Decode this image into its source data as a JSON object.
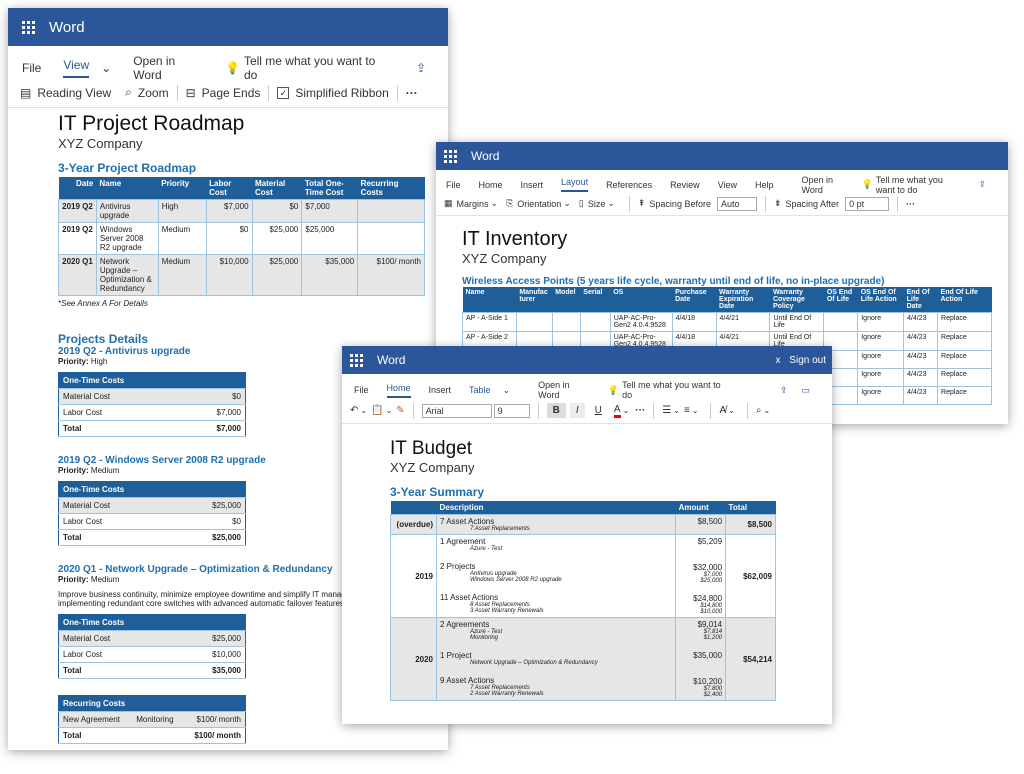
{
  "win1": {
    "app": "Word",
    "menu": [
      "File",
      "View",
      "Open in Word",
      "Tell me what you want to do"
    ],
    "toolbar": {
      "reading": "Reading View",
      "zoom": "Zoom",
      "page_ends": "Page Ends",
      "simplified": "Simplified Ribbon",
      "more": "···"
    },
    "doc": {
      "title": "IT Project Roadmap",
      "company": "XYZ Company",
      "section": "3-Year Project Roadmap",
      "headers": [
        "Date",
        "Name",
        "Priority",
        "Labor Cost",
        "Material Cost",
        "Total One-Time Cost",
        "Recurring Costs"
      ],
      "rows": [
        [
          "2019 Q2",
          "Antivirus upgrade",
          "High",
          "$7,000",
          "$0",
          "$7,000",
          ""
        ],
        [
          "2019 Q2",
          "Windows Server 2008 R2 upgrade",
          "Medium",
          "$0",
          "$25,000",
          "$25,000",
          ""
        ],
        [
          "2020 Q1",
          "Network Upgrade – Optimization & Redundancy",
          "Medium",
          "$10,000",
          "$25,000",
          "$35,000",
          "$100/ month"
        ]
      ],
      "note": "*See Annex A For Details",
      "projects_title": "Projects Details",
      "p1": {
        "title": "2019 Q2 - Antivirus upgrade",
        "priority_label": "Priority:",
        "priority": "High"
      },
      "p2": {
        "title": "2019 Q2 - Windows Server 2008 R2 upgrade",
        "priority_label": "Priority:",
        "priority": "Medium"
      },
      "p3": {
        "title": "2020 Q1 - Network Upgrade – Optimization & Redundancy",
        "priority_label": "Priority:",
        "priority": "Medium",
        "body1": "Improve business continuity, minimize employee downtime and simplify IT manage",
        "body2": "implementing redundant core switches with advanced automatic failover features t"
      },
      "otc": "One-Time Costs",
      "mat": "Material Cost",
      "lab": "Labor Cost",
      "total": "Total",
      "c1": {
        "mat": "$0",
        "lab": "$7,000",
        "total": "$7,000"
      },
      "c2": {
        "mat": "$25,000",
        "lab": "$0",
        "total": "$25,000"
      },
      "c3": {
        "mat": "$25,000",
        "lab": "$10,000",
        "total": "$35,000"
      },
      "rec": {
        "title": "Recurring Costs",
        "a": "New Agreement",
        "b": "Monitoring",
        "c": "$100/ month",
        "total": "Total",
        "total_v": "$100/ month"
      }
    }
  },
  "win2": {
    "app": "Word",
    "menu": [
      "File",
      "Home",
      "Insert",
      "Layout",
      "References",
      "Review",
      "View",
      "Help",
      "Open in Word",
      "Tell me what you want to do"
    ],
    "toolbar": {
      "margins": "Margins",
      "orientation": "Orientation",
      "size": "Size",
      "before": "Spacing Before",
      "before_v": "Auto",
      "after": "Spacing After",
      "after_v": "0 pt",
      "more": "···"
    },
    "doc": {
      "title": "IT Inventory",
      "company": "XYZ Company",
      "section": "Wireless Access Points (5 years life cycle, warranty until end of life, no in-place upgrade)",
      "headers": [
        "Name",
        "Manufac turer",
        "Model",
        "Serial",
        "OS",
        "Purchase Date",
        "Warranty Expiration Date",
        "Warranty Coverage Policy",
        "OS End Of Life",
        "OS End Of Life Action",
        "End Of Life Date",
        "End Of Life Action"
      ],
      "rows": [
        [
          "AP - A-Side 1",
          "",
          "",
          "",
          "UAP-AC-Pro-Gen2 4.0.4.9528",
          "4/4/18",
          "4/4/21",
          "Until End Of Life",
          "",
          "Ignore",
          "4/4/23",
          "Replace"
        ],
        [
          "AP - A-Side 2",
          "",
          "",
          "",
          "UAP-AC-Pro-Gen2 4.0.4.9528",
          "4/4/18",
          "4/4/21",
          "Until End Of Life",
          "",
          "Ignore",
          "4/4/23",
          "Replace"
        ],
        [
          "",
          "",
          "",
          "",
          "",
          "",
          "",
          "",
          "",
          "Ignore",
          "4/4/23",
          "Replace"
        ],
        [
          "",
          "",
          "",
          "",
          "",
          "",
          "",
          "",
          "",
          "Ignore",
          "4/4/23",
          "Replace"
        ],
        [
          "",
          "",
          "",
          "",
          "",
          "",
          "",
          "",
          "",
          "Ignore",
          "4/4/23",
          "Replace"
        ]
      ]
    }
  },
  "win3": {
    "app": "Word",
    "signout": "Sign out",
    "menu": [
      "File",
      "Home",
      "Insert",
      "Table",
      "Open in Word",
      "Tell me what you want to do"
    ],
    "toolbar": {
      "font": "Arial",
      "size": "9",
      "bold": "B",
      "italic": "I",
      "underline": "U",
      "color": "A",
      "more": "···"
    },
    "doc": {
      "title": "IT Budget",
      "company": "XYZ Company",
      "section": "3-Year Summary",
      "headers": [
        "",
        "Description",
        "Amount",
        "Total"
      ],
      "overdue": {
        "label": "(overdue)",
        "d1": "7 Asset Actions",
        "d2": "7 Asset Replacements",
        "amount": "$8,500",
        "total": "$8,500"
      },
      "y2019": {
        "label": "2019",
        "total": "$62,009",
        "items": [
          {
            "d": "1 Agreement",
            "subs": [
              "Azure - Test"
            ],
            "a": "$5,209",
            "sa": []
          },
          {
            "d": "2 Projects",
            "subs": [
              "Antivirus upgrade",
              "Windows Server 2008 R2 upgrade"
            ],
            "a": "$32,000",
            "sa": [
              "$7,000",
              "$25,000"
            ]
          },
          {
            "d": "11 Asset Actions",
            "subs": [
              "8 Asset Replacements",
              "3 Asset Warranty Renewals"
            ],
            "a": "$24,800",
            "sa": [
              "$14,800",
              "$10,000"
            ]
          }
        ]
      },
      "y2020": {
        "label": "2020",
        "total": "$54,214",
        "items": [
          {
            "d": "2 Agreements",
            "subs": [
              "Azure - Test",
              "Monitoring"
            ],
            "a": "$9,014",
            "sa": [
              "$7,814",
              "$1,200"
            ]
          },
          {
            "d": "1 Project",
            "subs": [
              "Network Upgrade – Optimization & Redundancy"
            ],
            "a": "$35,000",
            "sa": []
          },
          {
            "d": "9 Asset Actions",
            "subs": [
              "7 Asset Replacements",
              "2 Asset Warranty Renewals"
            ],
            "a": "$10,200",
            "sa": [
              "$7,800",
              "$2,400"
            ]
          }
        ]
      }
    }
  }
}
